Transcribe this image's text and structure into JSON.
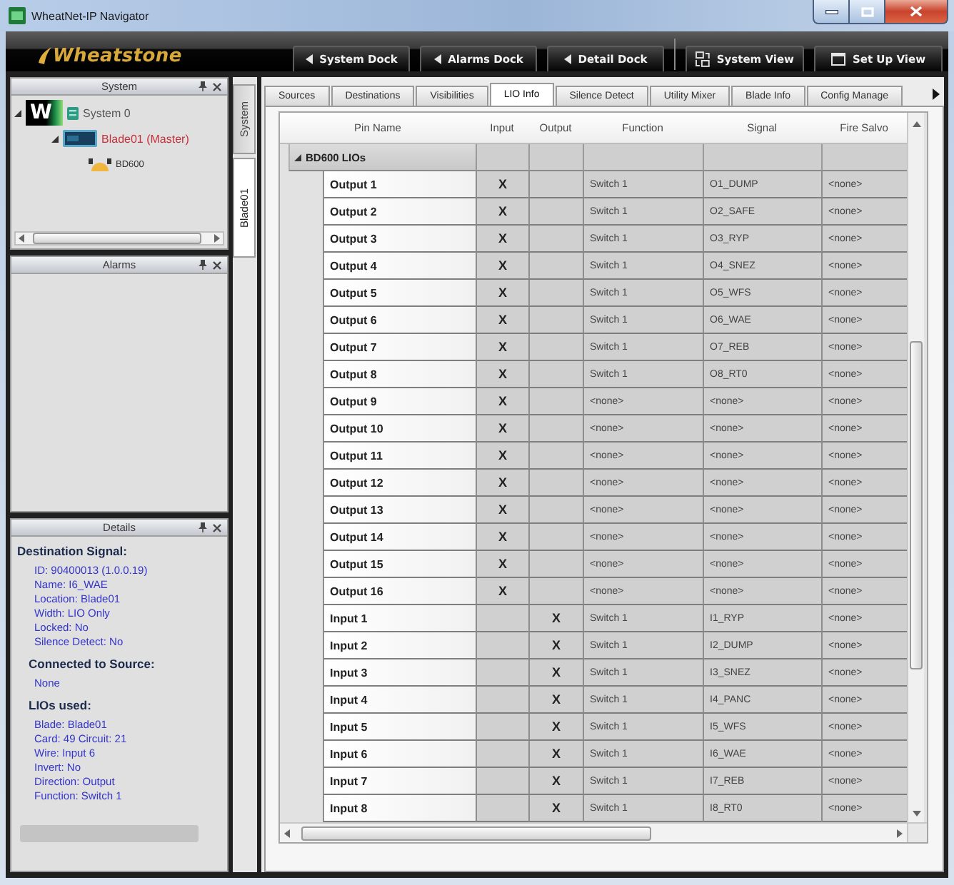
{
  "window": {
    "title": "WheatNet-IP Navigator"
  },
  "toolbar": {
    "logo": "Wheatstone",
    "buttons": [
      {
        "label": "System Dock",
        "kind": "dock"
      },
      {
        "label": "Alarms Dock",
        "kind": "dock"
      },
      {
        "label": "Detail Dock",
        "kind": "dock"
      },
      {
        "label": "System View",
        "kind": "view"
      },
      {
        "label": "Set Up View",
        "kind": "setup"
      }
    ]
  },
  "system_panel": {
    "title": "System",
    "tree": [
      {
        "label": "System 0",
        "kind": "system",
        "logo": "W",
        "expanded": true,
        "children": [
          {
            "label": "Blade01 (Master)",
            "kind": "blade",
            "expanded": true,
            "children": [
              {
                "label": "BD600",
                "kind": "card"
              }
            ]
          }
        ]
      }
    ]
  },
  "alarms_panel": {
    "title": "Alarms"
  },
  "details_panel": {
    "title": "Details",
    "sections": [
      {
        "heading": "Destination Signal:",
        "lines": [
          "ID: 90400013 (1.0.0.19)",
          "Name: I6_WAE",
          "Location: Blade01",
          "Width: LIO Only",
          "Locked: No",
          "Silence Detect: No"
        ],
        "children": [
          {
            "heading": "Connected to Source:",
            "lines": [
              "None"
            ]
          },
          {
            "heading": "LIOs used:",
            "lines": [
              "Blade: Blade01",
              "Card: 49 Circuit: 21",
              "Wire: Input 6",
              "Invert: No",
              "Direction: Output",
              "Function: Switch 1"
            ]
          }
        ]
      }
    ]
  },
  "side_tabs": [
    {
      "label": "System",
      "selected": false
    },
    {
      "label": "Blade01",
      "selected": true
    }
  ],
  "tabs": [
    {
      "label": "Sources",
      "selected": false
    },
    {
      "label": "Destinations",
      "selected": false
    },
    {
      "label": "Visibilities",
      "selected": false
    },
    {
      "label": "LIO Info",
      "selected": true
    },
    {
      "label": "Silence Detect",
      "selected": false
    },
    {
      "label": "Utility Mixer",
      "selected": false
    },
    {
      "label": "Blade Info",
      "selected": false
    },
    {
      "label": "Config Manage",
      "selected": false
    }
  ],
  "grid": {
    "columns": [
      "Pin Name",
      "Input",
      "Output",
      "Function",
      "Signal",
      "Fire Salvo"
    ],
    "groups": [
      {
        "label": "BD600 LIOs",
        "expanded": true,
        "rows": [
          {
            "pin_name": "Output 1",
            "input": "X",
            "function": "Switch 1",
            "signal": "O1_DUMP",
            "fire_salvo": "<none>"
          },
          {
            "pin_name": "Output 2",
            "input": "X",
            "function": "Switch 1",
            "signal": "O2_SAFE",
            "fire_salvo": "<none>"
          },
          {
            "pin_name": "Output 3",
            "input": "X",
            "function": "Switch 1",
            "signal": "O3_RYP",
            "fire_salvo": "<none>"
          },
          {
            "pin_name": "Output 4",
            "input": "X",
            "function": "Switch 1",
            "signal": "O4_SNEZ",
            "fire_salvo": "<none>"
          },
          {
            "pin_name": "Output 5",
            "input": "X",
            "function": "Switch 1",
            "signal": "O5_WFS",
            "fire_salvo": "<none>"
          },
          {
            "pin_name": "Output 6",
            "input": "X",
            "function": "Switch 1",
            "signal": "O6_WAE",
            "fire_salvo": "<none>"
          },
          {
            "pin_name": "Output 7",
            "input": "X",
            "function": "Switch 1",
            "signal": "O7_REB",
            "fire_salvo": "<none>"
          },
          {
            "pin_name": "Output 8",
            "input": "X",
            "function": "Switch 1",
            "signal": "O8_RT0",
            "fire_salvo": "<none>"
          },
          {
            "pin_name": "Output 9",
            "input": "X",
            "function": "<none>",
            "signal": "<none>",
            "fire_salvo": "<none>"
          },
          {
            "pin_name": "Output 10",
            "input": "X",
            "function": "<none>",
            "signal": "<none>",
            "fire_salvo": "<none>"
          },
          {
            "pin_name": "Output 11",
            "input": "X",
            "function": "<none>",
            "signal": "<none>",
            "fire_salvo": "<none>"
          },
          {
            "pin_name": "Output 12",
            "input": "X",
            "function": "<none>",
            "signal": "<none>",
            "fire_salvo": "<none>"
          },
          {
            "pin_name": "Output 13",
            "input": "X",
            "function": "<none>",
            "signal": "<none>",
            "fire_salvo": "<none>"
          },
          {
            "pin_name": "Output 14",
            "input": "X",
            "function": "<none>",
            "signal": "<none>",
            "fire_salvo": "<none>"
          },
          {
            "pin_name": "Output 15",
            "input": "X",
            "function": "<none>",
            "signal": "<none>",
            "fire_salvo": "<none>"
          },
          {
            "pin_name": "Output 16",
            "input": "X",
            "function": "<none>",
            "signal": "<none>",
            "fire_salvo": "<none>"
          },
          {
            "pin_name": "Input 1",
            "output": "X",
            "function": "Switch 1",
            "signal": "I1_RYP",
            "fire_salvo": "<none>"
          },
          {
            "pin_name": "Input 2",
            "output": "X",
            "function": "Switch 1",
            "signal": "I2_DUMP",
            "fire_salvo": "<none>"
          },
          {
            "pin_name": "Input 3",
            "output": "X",
            "function": "Switch 1",
            "signal": "I3_SNEZ",
            "fire_salvo": "<none>"
          },
          {
            "pin_name": "Input 4",
            "output": "X",
            "function": "Switch 1",
            "signal": "I4_PANC",
            "fire_salvo": "<none>"
          },
          {
            "pin_name": "Input 5",
            "output": "X",
            "function": "Switch 1",
            "signal": "I5_WFS",
            "fire_salvo": "<none>"
          },
          {
            "pin_name": "Input 6",
            "output": "X",
            "function": "Switch 1",
            "signal": "I6_WAE",
            "fire_salvo": "<none>"
          },
          {
            "pin_name": "Input 7",
            "output": "X",
            "function": "Switch 1",
            "signal": "I7_REB",
            "fire_salvo": "<none>"
          },
          {
            "pin_name": "Input 8",
            "output": "X",
            "function": "Switch 1",
            "signal": "I8_RT0",
            "fire_salvo": "<none>"
          }
        ]
      }
    ]
  }
}
